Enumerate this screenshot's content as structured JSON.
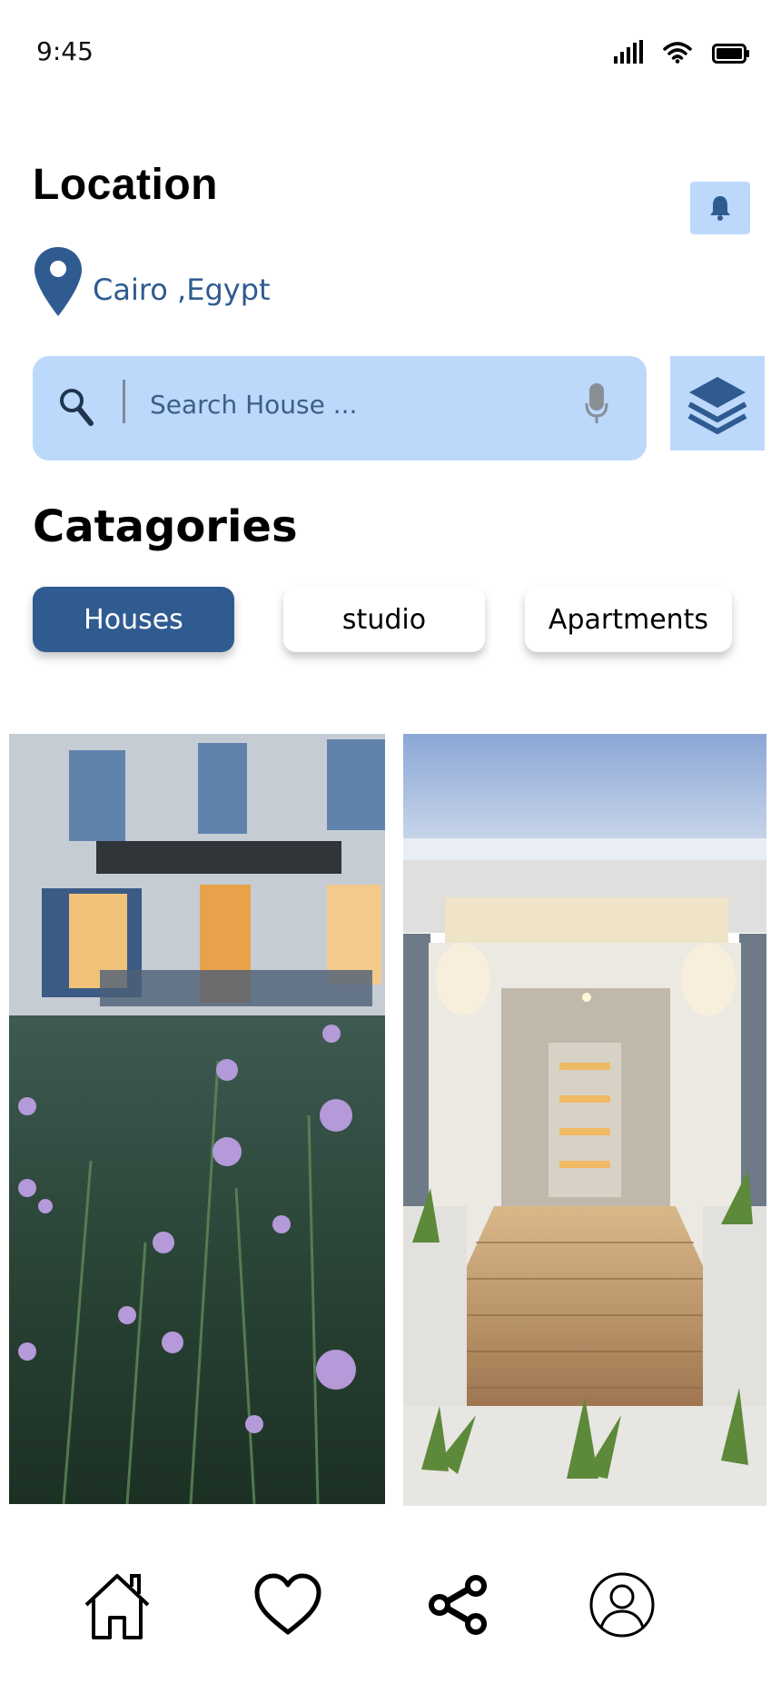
{
  "status": {
    "time": "9:45"
  },
  "header": {
    "title": "Location"
  },
  "location": {
    "city": "Cairo ,Egypt"
  },
  "search": {
    "placeholder": "Search House ..."
  },
  "categories": {
    "title": "Catagories",
    "items": [
      {
        "label": "Houses",
        "active": true
      },
      {
        "label": "studio",
        "active": false
      },
      {
        "label": "Apartments",
        "active": false
      }
    ]
  },
  "listings": [
    {
      "image": "house-with-wildflowers-photo"
    },
    {
      "image": "modern-house-entrance-photo"
    }
  ],
  "nav": [
    "home-icon",
    "heart-icon",
    "share-icon",
    "profile-icon"
  ],
  "colors": {
    "accent": "#2f5b90",
    "light_accent": "#bcd8fb"
  }
}
